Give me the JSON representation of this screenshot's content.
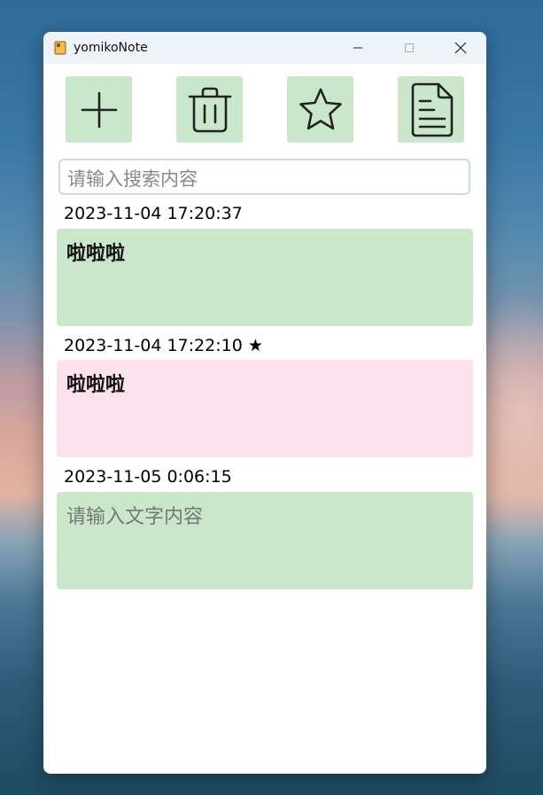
{
  "window": {
    "title": "yomikoNote"
  },
  "toolbar": {
    "buttons": [
      {
        "name": "add",
        "icon": "plus-icon"
      },
      {
        "name": "delete",
        "icon": "trash-icon"
      },
      {
        "name": "favorite",
        "icon": "star-icon"
      },
      {
        "name": "document",
        "icon": "document-icon"
      }
    ]
  },
  "search": {
    "placeholder": "请输入搜索内容"
  },
  "notes": [
    {
      "date": "2023-11-04 17:20:37",
      "text": "啦啦啦",
      "color": "#cae7cc"
    },
    {
      "date": "2023-11-04 17:22:10 ★",
      "text": "啦啦啦",
      "color": "#fde2ee"
    },
    {
      "date": "2023-11-05 0:06:15",
      "text": "",
      "placeholder": "请输入文字内容",
      "color": "#cae7cc"
    }
  ],
  "colors": {
    "accent_green": "#cae7cc",
    "favorite_pink": "#fde2ee"
  }
}
